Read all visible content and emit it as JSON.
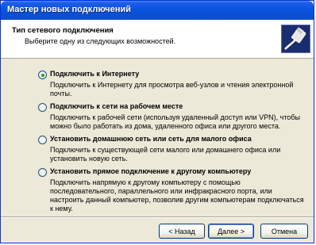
{
  "window": {
    "title": "Мастер новых подключений"
  },
  "header": {
    "title": "Тип сетевого подключения",
    "subtitle": "Выберите одну из следующих возможностей."
  },
  "options": [
    {
      "label": "Подключить к Интернету",
      "description": "Подключить к Интернету для просмотра веб-узлов и чтения  электронной почты.",
      "checked": true
    },
    {
      "label": "Подключить к сети на рабочем месте",
      "description": "Подключить к рабочей сети (используя удаленный доступ или VPN), чтобы можно было работать из дома, удаленного офиса или другого места.",
      "checked": false
    },
    {
      "label": "Установить домашнюю сеть или сеть для малого офиса",
      "description": "Подключить к существующей сети малого или домашнего офиса или установить новую сеть.",
      "checked": false
    },
    {
      "label": "Установить прямое подключение к другому компьютеру",
      "description": "Подключить напрямую к другому компьютеру с помощью последовательного, параллельного или инфракрасного порта, или настроить данный компьютер, позволив другим  компьютерам подключаться к нему.",
      "checked": false
    }
  ],
  "buttons": {
    "back": "< Назад",
    "next": "Далее >",
    "cancel": "Отмена"
  },
  "icons": {
    "header_icon": "network-cable-icon"
  },
  "colors": {
    "titlebar": "#0a4fd4",
    "radio_selected": "#21a121",
    "window_bg": "#ece9d8"
  }
}
